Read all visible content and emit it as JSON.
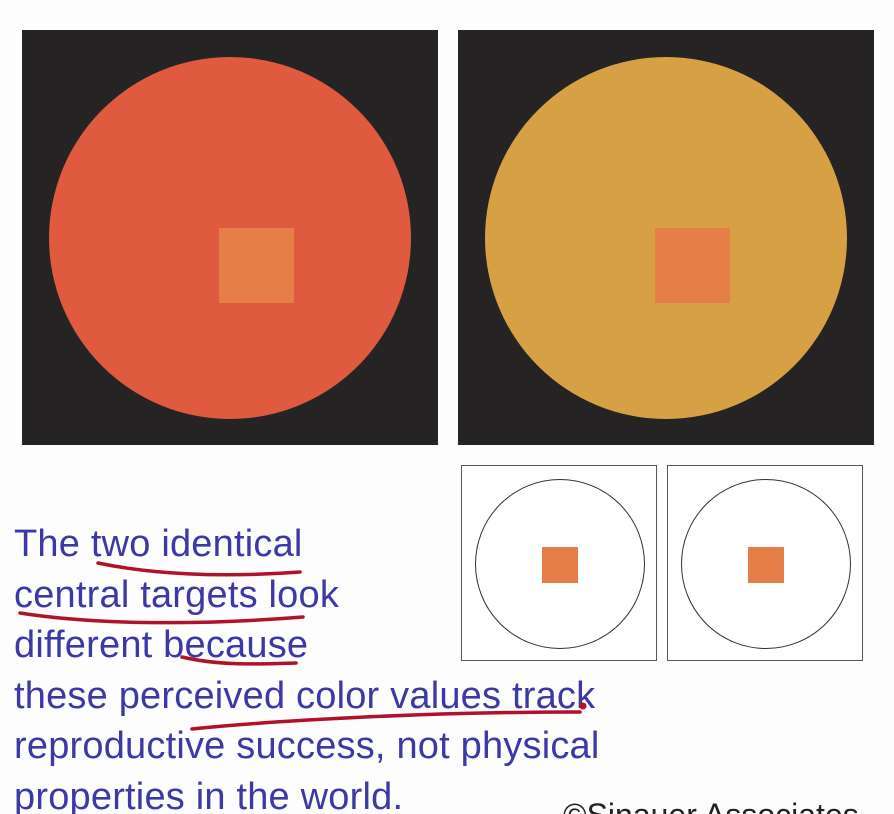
{
  "colors": {
    "panel_background": "#252323",
    "left_disk": "#df5a3f",
    "right_disk": "#d8a044",
    "target": "#e57f47",
    "caption_text": "#3a39a6",
    "annotation_ink": "#b0122a"
  },
  "caption": {
    "line1": "The two identical",
    "line2": "central targets look",
    "line3": "different because",
    "line4": "these perceived color values track",
    "line5": "reproductive success, not physical",
    "line6": "properties in the world."
  },
  "credit": {
    "text": "©Sinauer Associates"
  }
}
